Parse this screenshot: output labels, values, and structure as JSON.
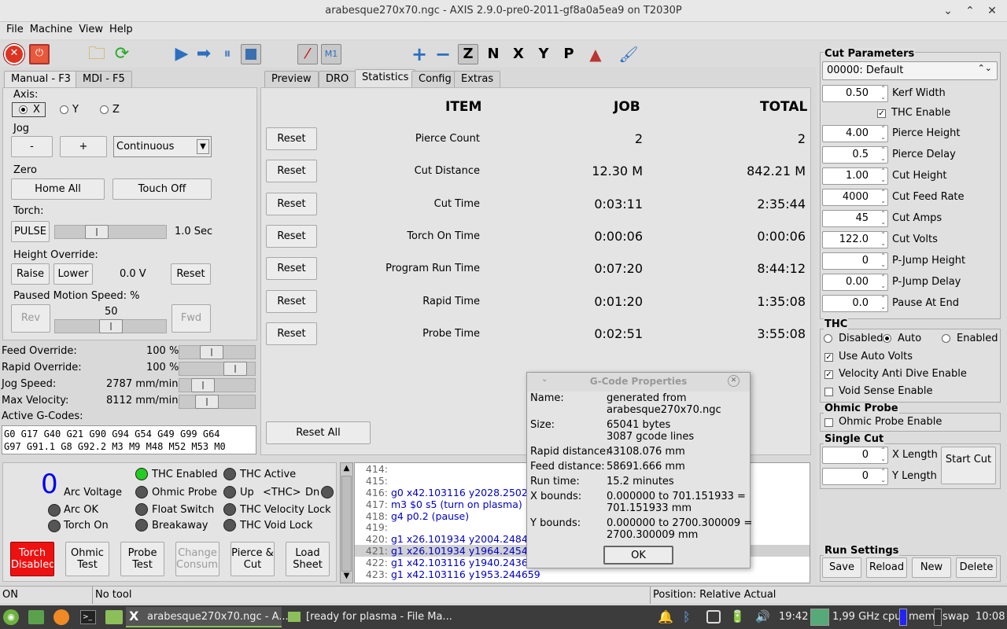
{
  "window": {
    "title": "arabesque270x70.ngc - AXIS 2.9.0-pre0-2011-gf8a0a5ea9 on T2030P"
  },
  "menu": [
    "File",
    "Machine",
    "View",
    "Help"
  ],
  "left_tabs": [
    "Manual - F3",
    "MDI - F5"
  ],
  "manual": {
    "axis_label": "Axis:",
    "axes": [
      "X",
      "Y",
      "Z"
    ],
    "jog_label": "Jog",
    "jog_minus": "-",
    "jog_plus": "+",
    "jog_mode": "Continuous",
    "zero_label": "Zero",
    "home_all": "Home All",
    "touch_off": "Touch Off",
    "torch_label": "Torch:",
    "pulse": "PULSE",
    "pulse_time": "1.0 Sec",
    "height_override_label": "Height Override:",
    "raise": "Raise",
    "lower": "Lower",
    "height_value": "0.0 V",
    "reset": "Reset",
    "paused_speed_label": "Paused Motion Speed: %",
    "paused_speed": "50",
    "paused_speed_fraction": 0.5,
    "rev": "Rev",
    "fwd": "Fwd"
  },
  "overrides": [
    {
      "label": "Feed Override:",
      "value": "100 %",
      "fraction": 0.4
    },
    {
      "label": "Rapid Override:",
      "value": "100 %",
      "fraction": 0.85
    },
    {
      "label": "Jog Speed:",
      "value": "2787 mm/min",
      "fraction": 0.22
    },
    {
      "label": "Max Velocity:",
      "value": "8112 mm/min",
      "fraction": 0.3
    }
  ],
  "gcodes": {
    "label": "Active G-Codes:",
    "line1": "G0 G17 G40 G21 G90 G94 G54 G49 G99 G64",
    "line2": "G97 G91.1 G8 G92.2 M3 M9 M48 M52 M53 M0"
  },
  "right_tabs": [
    "Preview",
    "DRO",
    "Statistics",
    "Config",
    "Extras"
  ],
  "stats": {
    "headers": [
      "ITEM",
      "JOB",
      "TOTAL"
    ],
    "reset_label": "Reset",
    "reset_all": "Reset All",
    "rows": [
      {
        "item": "Pierce Count",
        "job": "2",
        "total": "2"
      },
      {
        "item": "Cut Distance",
        "job": "12.30 M",
        "total": "842.21 M"
      },
      {
        "item": "Cut Time",
        "job": "0:03:11",
        "total": "2:35:44"
      },
      {
        "item": "Torch On Time",
        "job": "0:00:06",
        "total": "0:00:06"
      },
      {
        "item": "Program Run Time",
        "job": "0:07:20",
        "total": "8:44:12"
      },
      {
        "item": "Rapid Time",
        "job": "0:01:20",
        "total": "1:35:08"
      },
      {
        "item": "Probe Time",
        "job": "0:02:51",
        "total": "3:55:08"
      }
    ]
  },
  "cut_params": {
    "title": "Cut Parameters",
    "material": "00000: Default",
    "fields": [
      {
        "value": "0.50",
        "label": "Kerf Width"
      },
      {
        "value": "4.00",
        "label": "Pierce Height"
      },
      {
        "value": "0.5",
        "label": "Pierce Delay"
      },
      {
        "value": "1.00",
        "label": "Cut Height"
      },
      {
        "value": "4000",
        "label": "Cut Feed Rate"
      },
      {
        "value": "45",
        "label": "Cut Amps"
      },
      {
        "value": "122.0",
        "label": "Cut Volts"
      },
      {
        "value": "0",
        "label": "P-Jump Height"
      },
      {
        "value": "0.00",
        "label": "P-Jump Delay"
      },
      {
        "value": "0.0",
        "label": "Pause At End"
      }
    ],
    "thc_enable": "THC Enable"
  },
  "thc": {
    "title": "THC",
    "modes": [
      "Disabled",
      "Auto",
      "Enabled"
    ],
    "checks": [
      "Use Auto Volts",
      "Velocity Anti Dive Enable",
      "Void Sense Enable"
    ]
  },
  "ohmic": {
    "title": "Ohmic Probe",
    "check": "Ohmic Probe Enable"
  },
  "single_cut": {
    "title": "Single Cut",
    "x_value": "0",
    "x_label": "X Length",
    "y_value": "0",
    "y_label": "Y Length",
    "start": "Start Cut"
  },
  "run_settings": {
    "title": "Run Settings",
    "buttons": [
      "Save",
      "Reload",
      "New",
      "Delete"
    ]
  },
  "plasma": {
    "arc_voltage": "0",
    "arc_voltage_label": "Arc Voltage",
    "arc_ok": "Arc OK",
    "torch_on": "Torch On",
    "thc_enabled": "THC Enabled",
    "ohmic_probe": "Ohmic Probe",
    "float_switch": "Float Switch",
    "breakaway": "Breakaway",
    "thc_active": "THC Active",
    "up": "Up",
    "thc_tag": "<THC>",
    "dn": "Dn",
    "thc_velocity_lock": "THC Velocity Lock",
    "thc_void_lock": "THC Void Lock"
  },
  "plasma_buttons": [
    "Torch Disabled",
    "Ohmic Test",
    "Probe Test",
    "Change Consumable",
    "Pierce & Cut",
    "Load Sheet"
  ],
  "gcode_lines": [
    {
      "n": "414:",
      "t": ""
    },
    {
      "n": "415:",
      "t": ""
    },
    {
      "n": "416:",
      "t": "g0 x42.103116 y2028.2502"
    },
    {
      "n": "417:",
      "t": "m3 $0 s5 (turn on plasma)"
    },
    {
      "n": "418:",
      "t": "g4 p0.2 (pause)"
    },
    {
      "n": "419:",
      "t": ""
    },
    {
      "n": "420:",
      "t": "g1 x26.101934 y2004.2484"
    },
    {
      "n": "421:",
      "t": "g1 x26.101934 y1964.2454"
    },
    {
      "n": "422:",
      "t": "g1 x42.103116 y1940.2436"
    },
    {
      "n": "423:",
      "t": "g1 x42.103116 y1953.244659"
    }
  ],
  "dialog": {
    "title": "G-Code Properties",
    "rows": [
      {
        "k": "Name:",
        "v1": "generated from",
        "v2": "arabesque270x70.ngc"
      },
      {
        "k": "Size:",
        "v1": "65041 bytes",
        "v2": "3087 gcode lines"
      },
      {
        "k": "Rapid distance:",
        "v1": "43108.076 mm",
        "v2": ""
      },
      {
        "k": "Feed distance:",
        "v1": "58691.666 mm",
        "v2": ""
      },
      {
        "k": "Run time:",
        "v1": "15.2 minutes",
        "v2": ""
      },
      {
        "k": "X bounds:",
        "v1": "0.000000 to 701.151933 =",
        "v2": "701.151933 mm"
      },
      {
        "k": "Y bounds:",
        "v1": "0.000000 to 2700.300009 =",
        "v2": "2700.300009 mm"
      }
    ],
    "ok": "OK"
  },
  "status": {
    "state": "ON",
    "tool": "No tool",
    "position": "Position: Relative Actual"
  },
  "taskbar": {
    "app1": "arabesque270x70.ngc - A...",
    "app2": "[ready for plasma - File Ma...",
    "time1": "19:42",
    "cpu": "1,99 GHz cpu",
    "mem": "mem",
    "swap": "swap",
    "time2": "10:08"
  }
}
